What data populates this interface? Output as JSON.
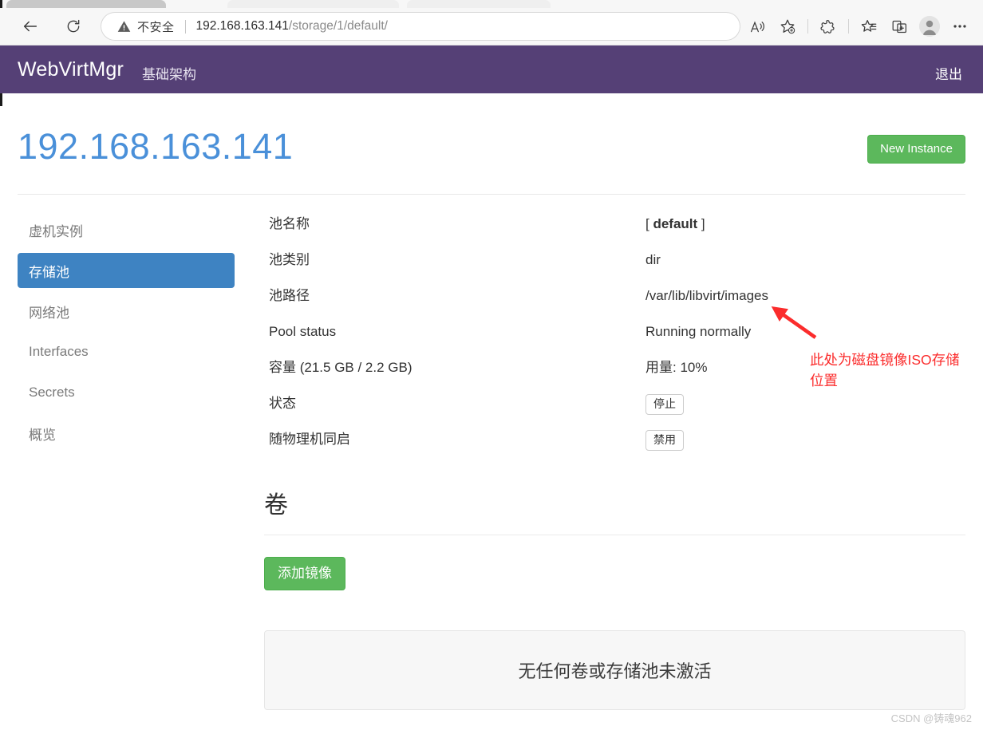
{
  "browser": {
    "back_icon": "arrow-left-icon",
    "reload_icon": "reload-icon",
    "security_icon": "warning-triangle-icon",
    "security_label": "不安全",
    "url_host": "192.168.163.141",
    "url_path": "/storage/1/default/",
    "toolbar_icons": [
      {
        "name": "read-aloud-icon",
        "glyph": "A"
      },
      {
        "name": "add-favorite-icon",
        "glyph": "star-plus"
      },
      {
        "name": "browser-essentials-icon",
        "glyph": "puzzle"
      },
      {
        "name": "favorites-icon",
        "glyph": "star-list"
      },
      {
        "name": "collections-icon",
        "glyph": "collections"
      },
      {
        "name": "profile-icon",
        "glyph": "avatar"
      },
      {
        "name": "settings-more-icon",
        "glyph": "..."
      }
    ]
  },
  "navbar": {
    "brand": "WebVirtMgr",
    "link": "基础架构",
    "logout": "退出"
  },
  "page": {
    "title": "192.168.163.141",
    "new_instance": "New Instance"
  },
  "sidebar": {
    "items": [
      {
        "label": "虚机实例",
        "active": false
      },
      {
        "label": "存储池",
        "active": true
      },
      {
        "label": "网络池",
        "active": false
      },
      {
        "label": "Interfaces",
        "active": false
      },
      {
        "label": "Secrets",
        "active": false
      },
      {
        "label": "概览",
        "active": false
      }
    ]
  },
  "details": [
    {
      "label": "池名称",
      "value": "[ default ]",
      "bold_value": "default",
      "kind": "bracketed"
    },
    {
      "label": "池类别",
      "value": "dir",
      "kind": "text"
    },
    {
      "label": "池路径",
      "value": "/var/lib/libvirt/images",
      "kind": "text"
    },
    {
      "label": "Pool status",
      "value": "Running normally",
      "kind": "text"
    },
    {
      "label": "容量 (21.5 GB / 2.2 GB)",
      "value": "用量: 10%",
      "kind": "text"
    },
    {
      "label": "状态",
      "value": "停止",
      "kind": "button"
    },
    {
      "label": "随物理机同启",
      "value": "禁用",
      "kind": "button"
    }
  ],
  "volumes": {
    "heading": "卷",
    "add_button": "添加镜像",
    "empty_message": "无任何卷或存储池未激活"
  },
  "annotation": {
    "text": "此处为磁盘镜像ISO存储位置",
    "color": "#fb2c2c"
  },
  "watermark": "CSDN @铸魂962",
  "colors": {
    "navbar_purple": "#554076",
    "title_blue": "#4a90d9",
    "active_item_blue": "#3e83c2",
    "green_button": "#5cb85c",
    "annotation_red": "#fb2c2c"
  }
}
